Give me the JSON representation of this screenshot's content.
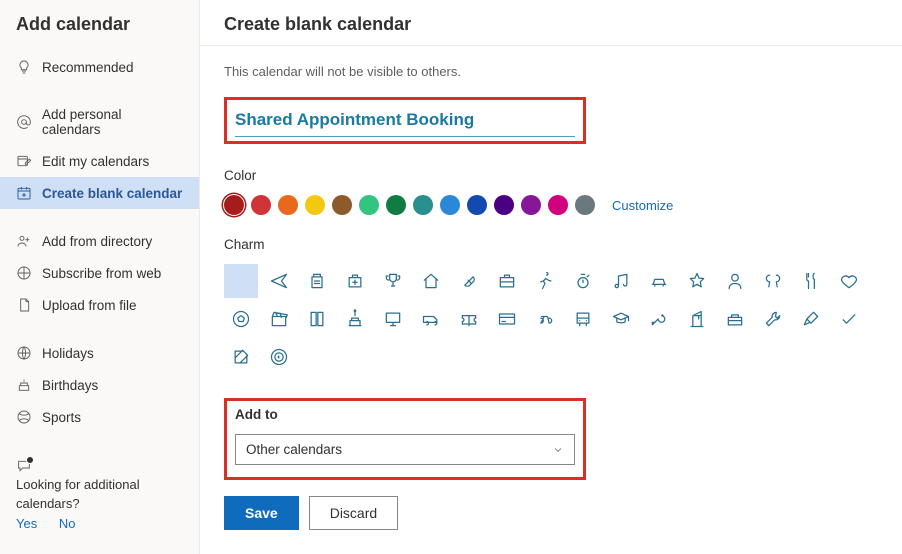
{
  "sidebar": {
    "title": "Add calendar",
    "items": [
      {
        "label": "Recommended",
        "icon": "lightbulb-icon"
      },
      {
        "label": "Add personal calendars",
        "icon": "at-sign-icon"
      },
      {
        "label": "Edit my calendars",
        "icon": "edit-calendars-icon"
      },
      {
        "label": "Create blank calendar",
        "icon": "blank-calendar-icon",
        "selected": true
      },
      {
        "label": "Add from directory",
        "icon": "people-directory-icon"
      },
      {
        "label": "Subscribe from web",
        "icon": "link-icon"
      },
      {
        "label": "Upload from file",
        "icon": "file-upload-icon"
      },
      {
        "label": "Holidays",
        "icon": "globe-icon"
      },
      {
        "label": "Birthdays",
        "icon": "cake-icon"
      },
      {
        "label": "Sports",
        "icon": "sports-icon"
      }
    ],
    "footer": {
      "text": "Looking for additional calendars?",
      "yes": "Yes",
      "no": "No"
    }
  },
  "main": {
    "title": "Create blank calendar",
    "subtext": "This calendar will not be visible to others.",
    "calendar_name": "Shared Appointment Booking",
    "color_label": "Color",
    "colors": [
      "#a61c1c",
      "#d13438",
      "#e8691d",
      "#f2c811",
      "#8c5a2b",
      "#33c481",
      "#107c41",
      "#2a8f8f",
      "#2b88d8",
      "#134aaf",
      "#4b0082",
      "#881798",
      "#d1007e",
      "#69797e"
    ],
    "selected_color_index": 0,
    "customize_label": "Customize",
    "charm_label": "Charm",
    "charms": [
      "none-icon",
      "plane-icon",
      "clipboard-icon",
      "medkit-icon",
      "trophy-icon",
      "home-icon",
      "pill-icon",
      "briefcase-icon",
      "running-icon",
      "stopwatch-icon",
      "music-icon",
      "car-icon",
      "star-icon",
      "person-icon",
      "balloons-icon",
      "fork-knife-icon",
      "heart-icon",
      "soccer-icon",
      "clapboard-icon",
      "book-icon",
      "birthday-cake-icon",
      "monitor-icon",
      "van-icon",
      "ticket-icon",
      "credit-card-icon",
      "bike-icon",
      "bus-icon",
      "graduation-icon",
      "key-icon",
      "crane-icon",
      "toolbox-icon",
      "wrench-icon",
      "paintbrush-icon",
      "checkmark-icon",
      "compose-icon",
      "target-icon"
    ],
    "selected_charm_index": 0,
    "addto_label": "Add to",
    "addto_value": "Other calendars",
    "save_label": "Save",
    "discard_label": "Discard"
  }
}
